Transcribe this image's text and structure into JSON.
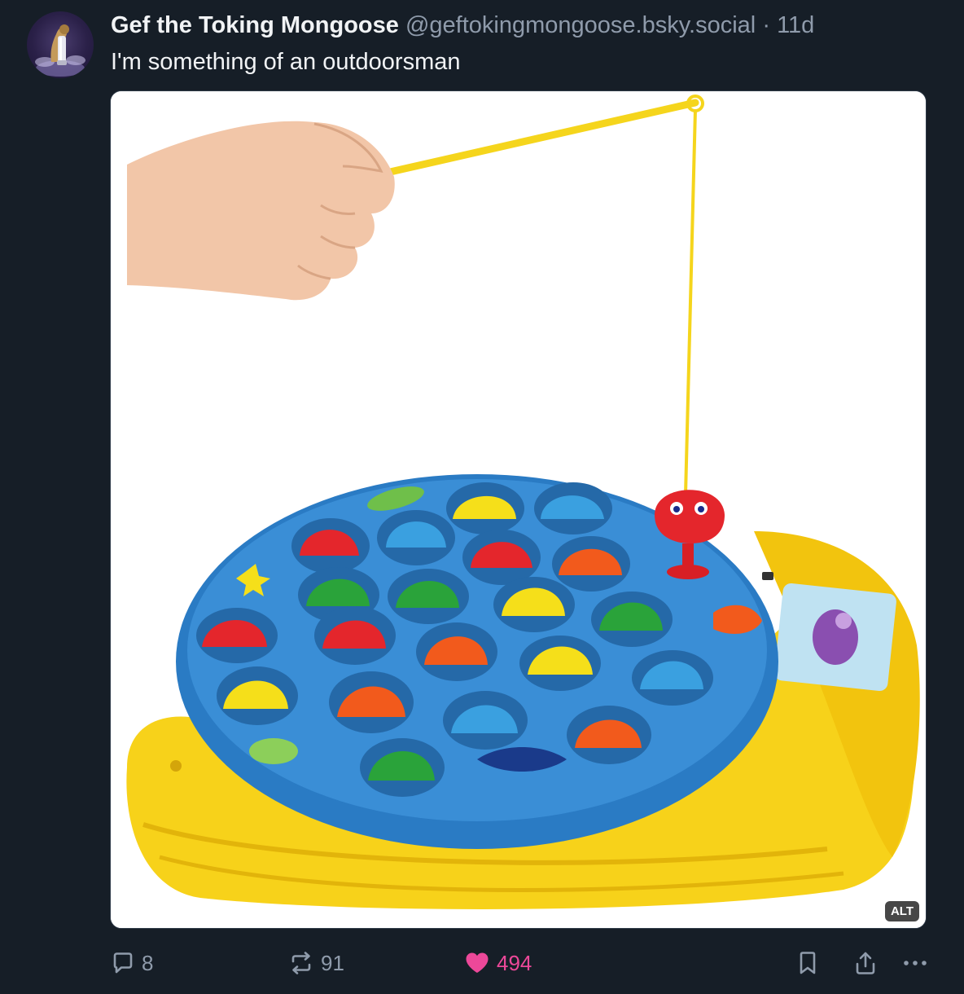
{
  "post": {
    "author": {
      "display_name": "Gef the Toking Mongoose",
      "handle": "@geftokingmongoose.bsky.social",
      "separator": "·",
      "age": "11d",
      "avatar_icon": "mongoose-avatar"
    },
    "text": "I'm something of an outdoorsman",
    "media": {
      "alt_badge": "ALT"
    },
    "actions": {
      "replies": "8",
      "reposts": "91",
      "likes": "494",
      "liked": true,
      "icons": {
        "reply": "reply-icon",
        "repost": "repost-icon",
        "like": "heart-icon",
        "bookmark": "bookmark-icon",
        "share": "share-icon",
        "more": "more-icon"
      }
    }
  },
  "colors": {
    "background": "#161e27",
    "text_primary": "#f1f3f5",
    "text_secondary": "#8f9bab",
    "like": "#ec4899"
  }
}
